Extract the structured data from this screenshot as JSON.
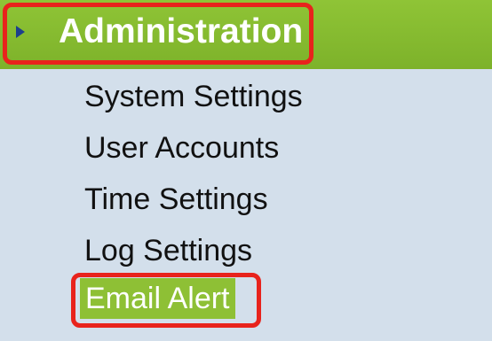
{
  "colors": {
    "header_green": "#85ba2f",
    "panel_bg": "#d3dfeb",
    "highlight_red": "#e8231c",
    "arrow_blue": "#1d3f8c",
    "active_item_bg": "#8ec035"
  },
  "menu": {
    "header": {
      "label": "Administration",
      "icon": "triangle-right-icon",
      "expanded": true
    },
    "items": [
      {
        "label": "System Settings",
        "active": false
      },
      {
        "label": "User Accounts",
        "active": false
      },
      {
        "label": "Time Settings",
        "active": false
      },
      {
        "label": "Log Settings",
        "active": false
      },
      {
        "label": "Email Alert",
        "active": true
      }
    ]
  }
}
